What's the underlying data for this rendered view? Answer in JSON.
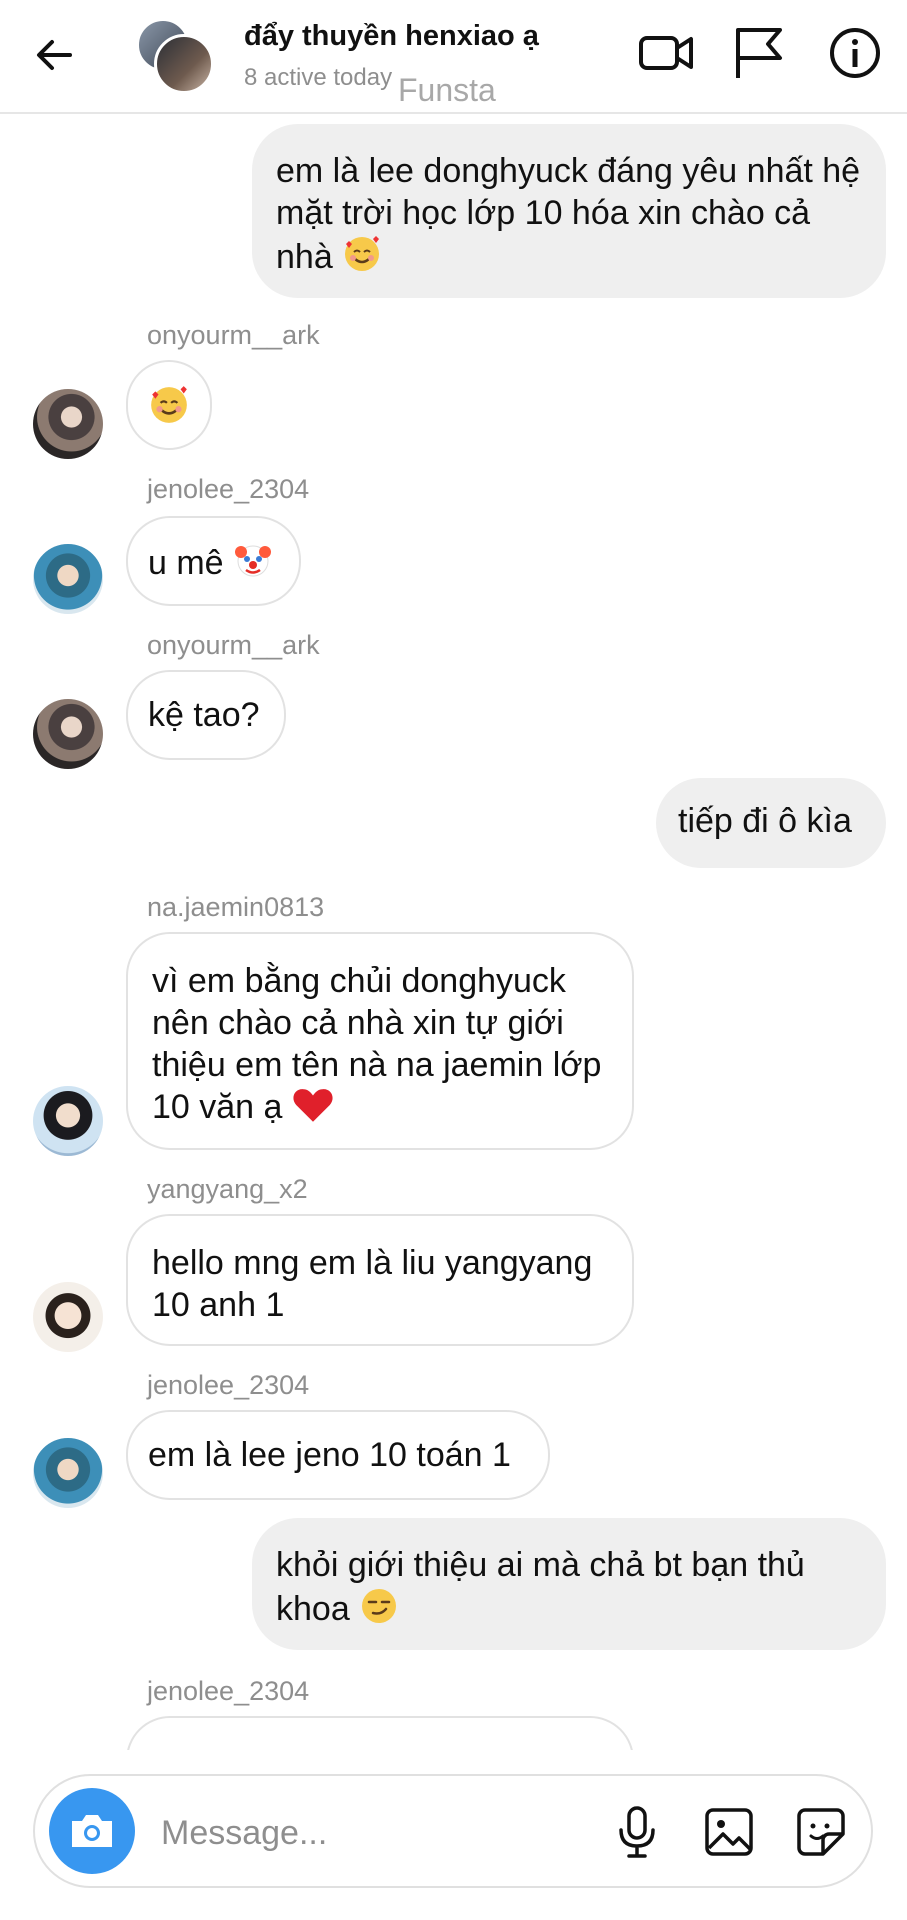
{
  "header": {
    "title": "đẩy thuyền henxiao ạ",
    "subtitle": "8 active today",
    "watermark": "Funsta",
    "icons": [
      "back-arrow-icon",
      "video-camera-icon",
      "flag-icon",
      "info-icon"
    ]
  },
  "messages": [
    {
      "type": "sent",
      "text": "em là lee donghyuck đáng yêu nhất hệ mặt trời học lớp 10 hóa xin chào cả nhà",
      "emoji": "smiling-face-with-hearts"
    },
    {
      "type": "recv",
      "username": "onyourm__ark",
      "text": "",
      "emoji": "smiling-face-with-hearts"
    },
    {
      "type": "recv",
      "username": "jenolee_2304",
      "text": "u mê",
      "emoji": "clown-face"
    },
    {
      "type": "recv",
      "username": "onyourm__ark",
      "text": "kệ tao?"
    },
    {
      "type": "sent",
      "text": "tiếp đi ô kìa"
    },
    {
      "type": "recv",
      "username": "na.jaemin0813",
      "text": "vì em bằng chủi donghyuck nên chào cả nhà xin tự giới thiệu em tên nà na jaemin lớp 10 văn ạ",
      "emoji": "red-heart"
    },
    {
      "type": "recv",
      "username": "yangyang_x2",
      "text": "hello mng em là liu yangyang 10 anh 1"
    },
    {
      "type": "recv",
      "username": "jenolee_2304",
      "text": "em là lee jeno 10 toán 1"
    },
    {
      "type": "sent",
      "text": "khỏi giới thiệu ai mà chả bt bạn thủ khoa",
      "emoji": "smirking-face"
    },
    {
      "type": "recv",
      "username": "jenolee_2304",
      "text": ""
    }
  ],
  "composer": {
    "placeholder": "Message...",
    "icons": [
      "camera-icon",
      "microphone-icon",
      "gallery-icon",
      "sticker-icon"
    ]
  },
  "colors": {
    "accent": "#3897f0",
    "sent_bubble": "#efefef",
    "muted_text": "#8e8e8e"
  }
}
